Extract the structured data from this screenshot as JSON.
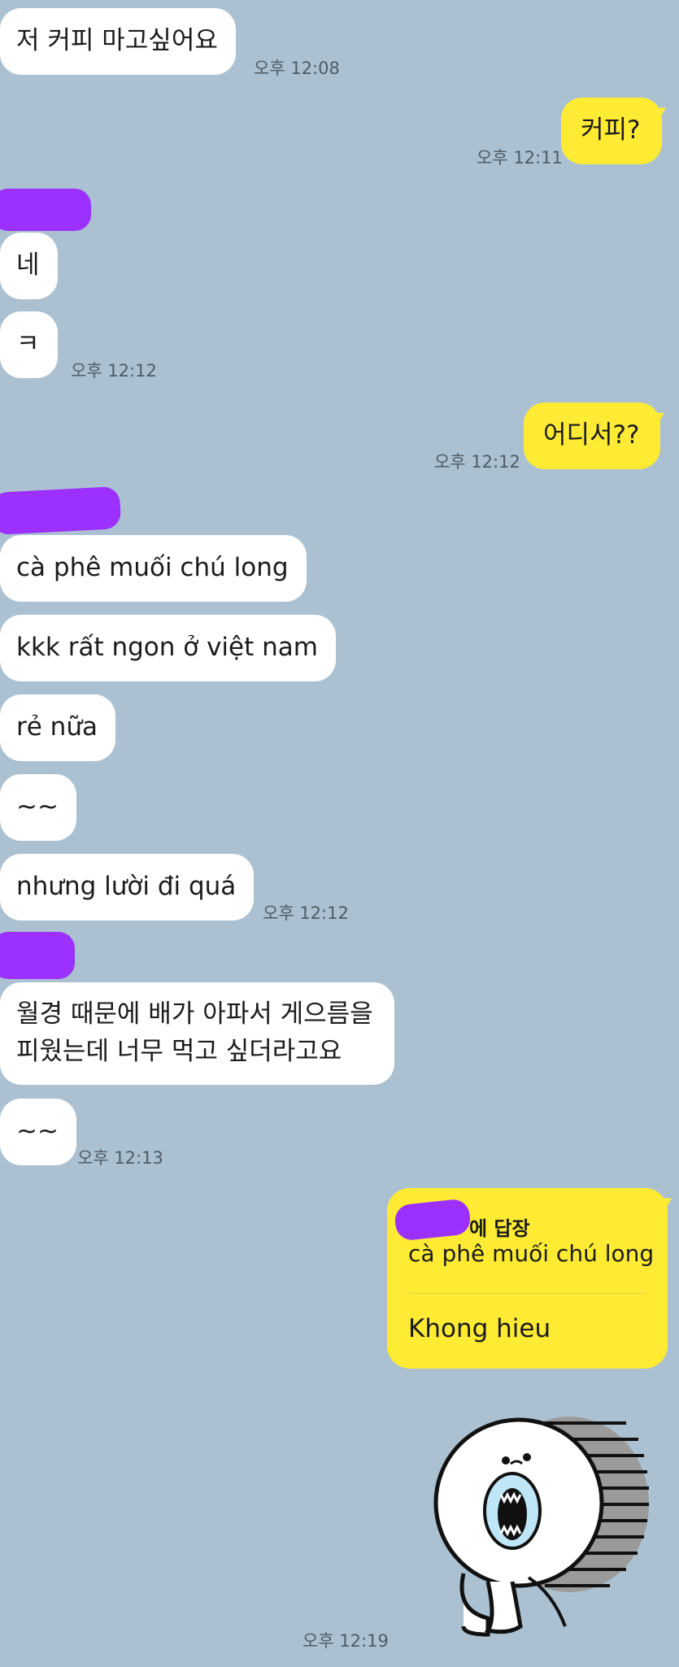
{
  "colors": {
    "background": "#abc1d1",
    "incoming_bubble": "#ffffff",
    "outgoing_bubble": "#ffeb33",
    "name_redaction": "#9b30ff",
    "timestamp": "#4f5b66"
  },
  "messages": [
    {
      "text": "저 커피 마고싶어요",
      "time": "오후 12:08"
    },
    {
      "text": "커피?",
      "time": "오후 12:11"
    },
    {
      "text": "네"
    },
    {
      "text": "ㅋ",
      "time": "오후 12:12"
    },
    {
      "text": "어디서??",
      "time": "오후 12:12"
    },
    {
      "text": "cà phê muối chú long"
    },
    {
      "text": "kkk rất ngon ở việt nam"
    },
    {
      "text": "rẻ nữa"
    },
    {
      "text": "~~"
    },
    {
      "text": "nhưng lười đi quá",
      "time": "오후 12:12"
    },
    {
      "text_line1": "월경 때문에 배가 아파서 게으름을",
      "text_line2": "피웠는데 너무 먹고 싶더라고요"
    },
    {
      "text": "~~",
      "time": "오후 12:13"
    }
  ],
  "reply": {
    "header": "에 답장",
    "quoted": "cà phê muối chú long",
    "text": "Khong hieu"
  },
  "sticker": {
    "icon": "laughing-white-blob-sticker-icon",
    "time": "오후 12:19"
  }
}
